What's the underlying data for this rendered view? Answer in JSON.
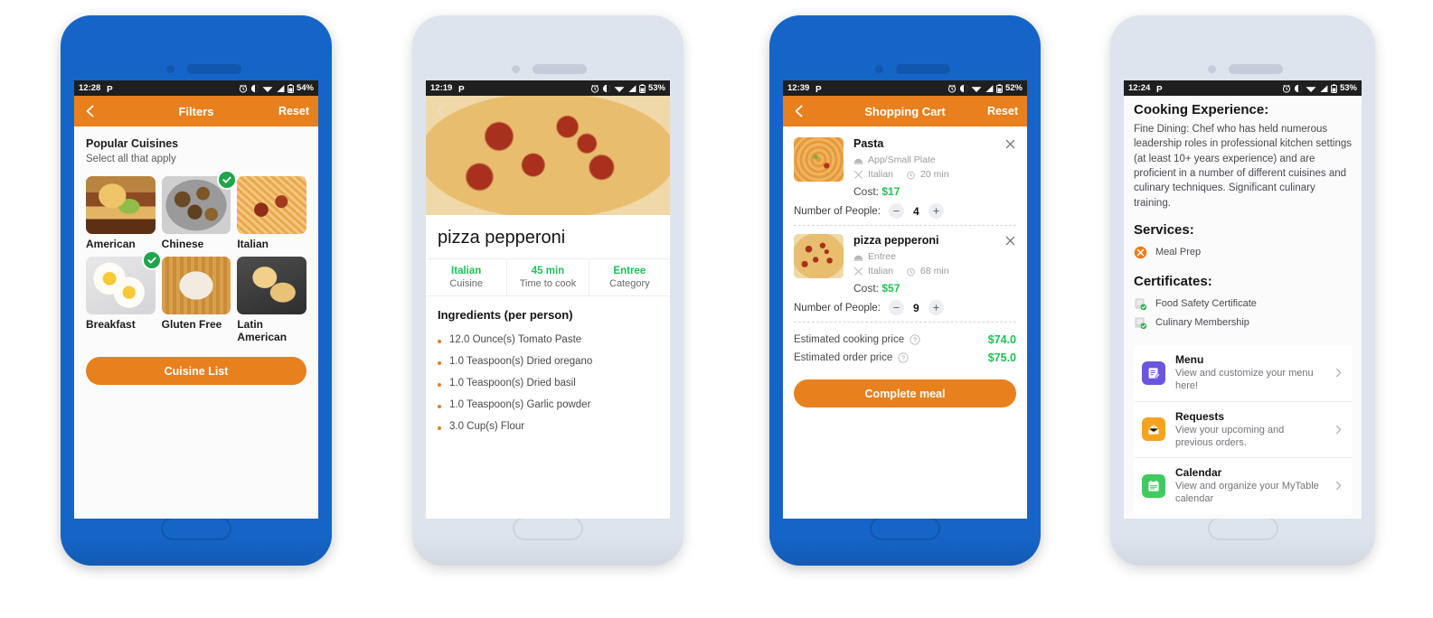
{
  "phones": {
    "filters": {
      "frame_color": "#1565C8",
      "status_bar": {
        "time": "12:28",
        "battery": "54%",
        "icons": [
          "parking-icon",
          "alarm-icon",
          "dnd-icon",
          "wifi-icon",
          "signal-icon",
          "battery-icon"
        ]
      },
      "appbar": {
        "back": "back-chevron-icon",
        "title": "Filters",
        "reset": "Reset"
      },
      "section_title": "Popular Cuisines",
      "section_sub": "Select all that apply",
      "tiles": [
        {
          "label": "American",
          "selected": false,
          "art": "f-burger"
        },
        {
          "label": "Chinese",
          "selected": true,
          "art": "f-chinese"
        },
        {
          "label": "Italian",
          "selected": false,
          "art": "f-italian"
        },
        {
          "label": "Breakfast",
          "selected": true,
          "art": "f-breakfast"
        },
        {
          "label": "Gluten Free",
          "selected": false,
          "art": "f-gluten"
        },
        {
          "label": "Latin American",
          "selected": false,
          "art": "f-latin"
        }
      ],
      "cta": "Cuisine List"
    },
    "recipe": {
      "frame_color": "#dde4ed",
      "status_bar": {
        "time": "12:19",
        "battery": "53%"
      },
      "back": "back-chevron-icon",
      "title": "pizza pepperoni",
      "stats": [
        {
          "value": "Italian",
          "label": "Cuisine"
        },
        {
          "value": "45 min",
          "label": "Time to cook"
        },
        {
          "value": "Entree",
          "label": "Category"
        }
      ],
      "ingredients_heading": "Ingredients (per person)",
      "ingredients": [
        "12.0 Ounce(s) Tomato Paste",
        "1.0 Teaspoon(s) Dried oregano",
        "1.0 Teaspoon(s) Dried basil",
        "1.0 Teaspoon(s) Garlic powder",
        "3.0 Cup(s) Flour"
      ]
    },
    "cart": {
      "frame_color": "#1565C8",
      "status_bar": {
        "time": "12:39",
        "battery": "52%"
      },
      "appbar": {
        "back": "back-chevron-icon",
        "title": "Shopping Cart",
        "reset": "Reset"
      },
      "items": [
        {
          "name": "Pasta",
          "art": "f-pasta",
          "course": "App/Small Plate",
          "cuisine": "Italian",
          "time": "20 min",
          "cost_label": "Cost:",
          "cost": "$17",
          "people_label": "Number of People:",
          "quantity": "4"
        },
        {
          "name": "pizza pepperoni",
          "art": "f-pizza",
          "course": "Entree",
          "cuisine": "Italian",
          "time": "68 min",
          "cost_label": "Cost:",
          "cost": "$57",
          "people_label": "Number of People:",
          "quantity": "9"
        }
      ],
      "prices": [
        {
          "label": "Estimated cooking price",
          "amount": "$74.0"
        },
        {
          "label": "Estimated order price",
          "amount": "$75.0"
        }
      ],
      "cta": "Complete meal"
    },
    "profile": {
      "frame_color": "#dde4ed",
      "status_bar": {
        "time": "12:24",
        "battery": "53%"
      },
      "experience_heading": "Cooking Experience:",
      "experience_text": "Fine Dining: Chef who has held numerous leadership roles in professional kitchen settings (at least 10+ years experience) and are proficient in a number of different cuisines and culinary techniques. Significant culinary training.",
      "services_heading": "Services:",
      "services": [
        {
          "label": "Meal Prep",
          "icon": "utensils-badge-icon"
        }
      ],
      "certificates_heading": "Certificates:",
      "certificates": [
        {
          "label": "Food Safety Certificate",
          "icon": "certificate-verified-icon"
        },
        {
          "label": "Culinary Membership",
          "icon": "certificate-verified-icon"
        }
      ],
      "menu_rows": [
        {
          "title": "Menu",
          "sub": "View and customize your menu here!",
          "icon": "menu-edit-icon",
          "color": "purple"
        },
        {
          "title": "Requests",
          "sub": "View your upcoming and previous orders.",
          "icon": "requests-inbox-icon",
          "color": "orange"
        },
        {
          "title": "Calendar",
          "sub": "View and organize your MyTable calendar",
          "icon": "calendar-icon",
          "color": "green"
        }
      ]
    }
  },
  "colors": {
    "orange": "#E8801E",
    "green": "#1DC254",
    "blue": "#1565C8"
  }
}
